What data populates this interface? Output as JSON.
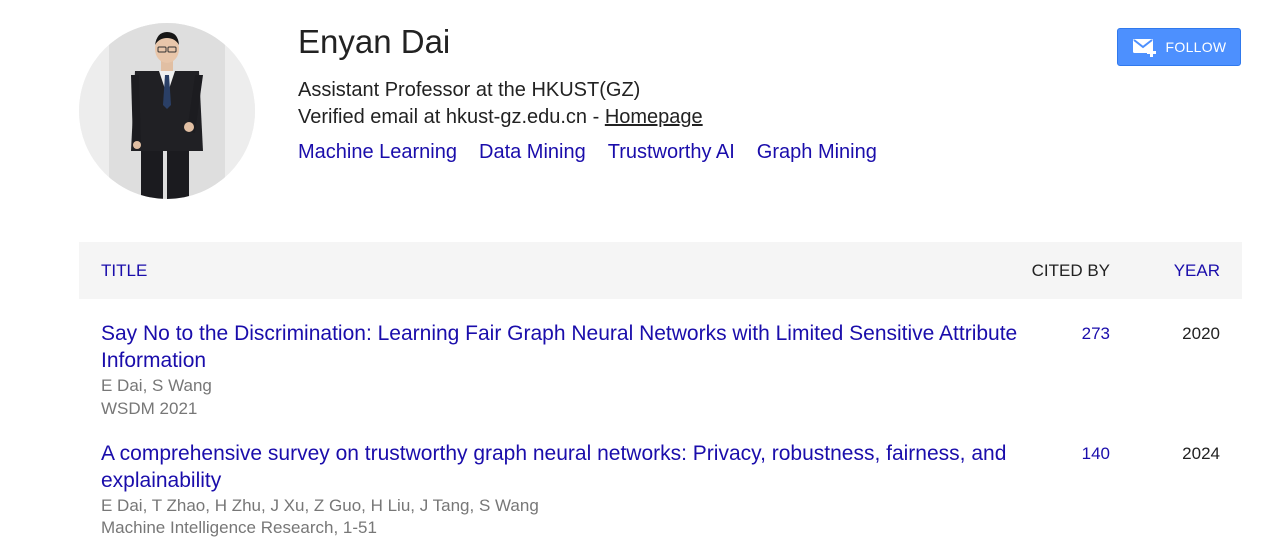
{
  "profile": {
    "name": "Enyan Dai",
    "affiliation": "Assistant Professor at the HKUST(GZ)",
    "email_prefix": "Verified email at hkust-gz.edu.cn - ",
    "homepage_label": "Homepage",
    "interests": [
      "Machine Learning",
      "Data Mining",
      "Trustworthy AI",
      "Graph Mining"
    ]
  },
  "follow": {
    "label": "FOLLOW",
    "icon": "mail-plus-icon"
  },
  "table": {
    "headers": {
      "title": "TITLE",
      "cited_by": "CITED BY",
      "year": "YEAR"
    },
    "rows": [
      {
        "title": "Say No to the Discrimination: Learning Fair Graph Neural Networks with Limited Sensitive Attribute Information",
        "authors": "E Dai, S Wang",
        "venue": "WSDM 2021",
        "cited_by": "273",
        "year": "2020"
      },
      {
        "title": "A comprehensive survey on trustworthy graph neural networks: Privacy, robustness, fairness, and explainability",
        "authors": "E Dai, T Zhao, H Zhu, J Xu, Z Guo, H Liu, J Tang, S Wang",
        "venue": "Machine Intelligence Research, 1-51",
        "cited_by": "140",
        "year": "2024"
      }
    ]
  },
  "colors": {
    "link": "#1a0dab",
    "follow_button": "#4d90fe",
    "header_bg": "#f5f5f5",
    "muted_text": "#777777"
  }
}
